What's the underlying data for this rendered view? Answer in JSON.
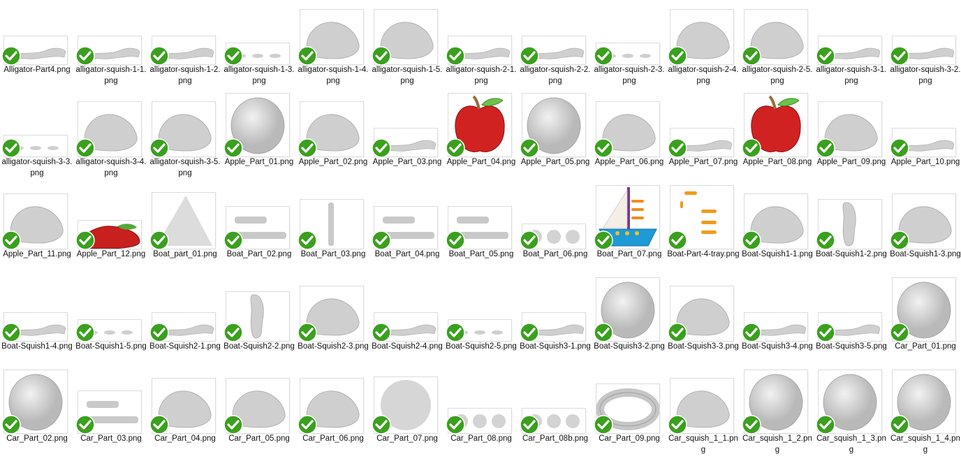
{
  "files": [
    {
      "name": "Alligator-Part4.png",
      "thumb": "clay-strand"
    },
    {
      "name": "alligator-squish-1-1.png",
      "thumb": "clay-strand"
    },
    {
      "name": "alligator-squish-1-2.png",
      "thumb": "clay-strand"
    },
    {
      "name": "alligator-squish-1-3.png",
      "thumb": "clay-dots"
    },
    {
      "name": "alligator-squish-1-4.png",
      "thumb": "clay-blob"
    },
    {
      "name": "alligator-squish-1-5.png",
      "thumb": "clay-blob"
    },
    {
      "name": "alligator-squish-2-1.png",
      "thumb": "clay-strand"
    },
    {
      "name": "alligator-squish-2-2.png",
      "thumb": "clay-strand"
    },
    {
      "name": "alligator-squish-2-3.png",
      "thumb": "clay-dots"
    },
    {
      "name": "alligator-squish-2-4.png",
      "thumb": "clay-blob"
    },
    {
      "name": "alligator-squish-2-5.png",
      "thumb": "clay-blob"
    },
    {
      "name": "alligator-squish-3-1.png",
      "thumb": "clay-strand"
    },
    {
      "name": "alligator-squish-3-2.png",
      "thumb": "clay-strand"
    },
    {
      "name": "alligator-squish-3-3.png",
      "thumb": "clay-dots"
    },
    {
      "name": "alligator-squish-3-4.png",
      "thumb": "clay-blob"
    },
    {
      "name": "alligator-squish-3-5.png",
      "thumb": "clay-blob"
    },
    {
      "name": "Apple_Part_01.png",
      "thumb": "clay-ball"
    },
    {
      "name": "Apple_Part_02.png",
      "thumb": "clay-blob"
    },
    {
      "name": "Apple_Part_03.png",
      "thumb": "clay-strand"
    },
    {
      "name": "Apple_Part_04.png",
      "thumb": "red-apple"
    },
    {
      "name": "Apple_Part_05.png",
      "thumb": "clay-ball"
    },
    {
      "name": "Apple_Part_06.png",
      "thumb": "clay-blob"
    },
    {
      "name": "Apple_Part_07.png",
      "thumb": "clay-strand"
    },
    {
      "name": "Apple_Part_08.png",
      "thumb": "red-apple"
    },
    {
      "name": "Apple_Part_09.png",
      "thumb": "clay-blob"
    },
    {
      "name": "Apple_Part_10.png",
      "thumb": "clay-strand"
    },
    {
      "name": "Apple_Part_11.png",
      "thumb": "clay-blob"
    },
    {
      "name": "Apple_Part_12.png",
      "thumb": "red-squish"
    },
    {
      "name": "Boat_part_01.png",
      "thumb": "grey-triangle"
    },
    {
      "name": "Boat_Part_02.png",
      "thumb": "grey-flat"
    },
    {
      "name": "Boat_Part_03.png",
      "thumb": "grey-bar"
    },
    {
      "name": "Boat_Part_04.png",
      "thumb": "grey-flat"
    },
    {
      "name": "Boat_Part_05.png",
      "thumb": "grey-flat"
    },
    {
      "name": "Boat_Part_06.png",
      "thumb": "grey-dots"
    },
    {
      "name": "Boat_Part_07.png",
      "thumb": "sailboat"
    },
    {
      "name": "Boat-Part-4-tray.png",
      "thumb": "orange-strokes"
    },
    {
      "name": "Boat-Squish1-1.png",
      "thumb": "clay-blob"
    },
    {
      "name": "Boat-Squish1-2.png",
      "thumb": "clay-bar"
    },
    {
      "name": "Boat-Squish1-3.png",
      "thumb": "clay-blob"
    },
    {
      "name": "Boat-Squish1-4.png",
      "thumb": "clay-strand"
    },
    {
      "name": "Boat-Squish1-5.png",
      "thumb": "clay-dots"
    },
    {
      "name": "Boat-Squish2-1.png",
      "thumb": "clay-strand"
    },
    {
      "name": "Boat-Squish2-2.png",
      "thumb": "clay-bar"
    },
    {
      "name": "Boat-Squish2-3.png",
      "thumb": "clay-blob"
    },
    {
      "name": "Boat-Squish2-4.png",
      "thumb": "clay-strand"
    },
    {
      "name": "Boat-Squish2-5.png",
      "thumb": "clay-dots"
    },
    {
      "name": "Boat-Squish3-1.png",
      "thumb": "clay-strand"
    },
    {
      "name": "Boat-Squish3-2.png",
      "thumb": "clay-ball"
    },
    {
      "name": "Boat-Squish3-3.png",
      "thumb": "clay-blob"
    },
    {
      "name": "Boat-Squish3-4.png",
      "thumb": "clay-strand"
    },
    {
      "name": "Boat-Squish3-5.png",
      "thumb": "clay-strand"
    },
    {
      "name": "Car_Part_01.png",
      "thumb": "clay-ball"
    },
    {
      "name": "Car_Part_02.png",
      "thumb": "clay-ball"
    },
    {
      "name": "Car_Part_03.png",
      "thumb": "grey-flat"
    },
    {
      "name": "Car_Part_04.png",
      "thumb": "clay-blob"
    },
    {
      "name": "Car_Part_05.png",
      "thumb": "clay-blob"
    },
    {
      "name": "Car_Part_06.png",
      "thumb": "clay-blob"
    },
    {
      "name": "Car_Part_07.png",
      "thumb": "grey-circle"
    },
    {
      "name": "Car_Part_08.png",
      "thumb": "grey-dots"
    },
    {
      "name": "Car_Part_08b.png",
      "thumb": "grey-dots"
    },
    {
      "name": "Car_Part_09.png",
      "thumb": "clay-ring"
    },
    {
      "name": "Car_squish_1_1.png",
      "thumb": "clay-blob"
    },
    {
      "name": "Car_squish_1_2.png",
      "thumb": "clay-ball"
    },
    {
      "name": "Car_squish_1_3.png",
      "thumb": "clay-ball"
    },
    {
      "name": "Car_squish_1_4.png",
      "thumb": "clay-ball"
    }
  ],
  "check_color": "#3aa01e",
  "folder": {
    "columns": 13
  }
}
